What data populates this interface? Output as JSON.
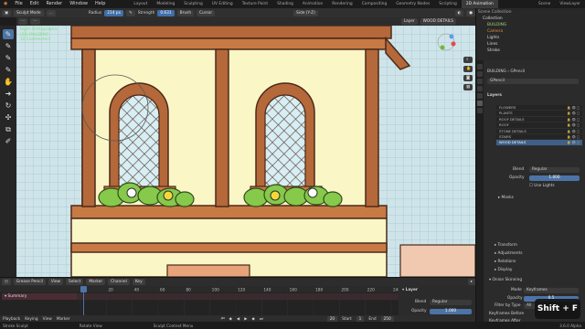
{
  "menubar": {
    "items": [
      "File",
      "Edit",
      "Render",
      "Window",
      "Help"
    ],
    "workspaces": [
      "Layout",
      "Modeling",
      "Sculpting",
      "UV Editing",
      "Texture Paint",
      "Shading",
      "Animation",
      "Rendering",
      "Compositing",
      "Geometry Nodes",
      "Scripting",
      "2D Animation"
    ],
    "active_workspace": "2D Animation",
    "scene_label": "Scene",
    "view_layer_label": "ViewLayer"
  },
  "header": {
    "mode": "Sculpt Mode",
    "radius_label": "Radius",
    "radius_value": "214 px",
    "strength_label": "Strength",
    "strength_value": "0.631",
    "brush": "Brush",
    "cursor": "Cursor",
    "view": "Side (Y-Z)"
  },
  "viewport_overlay": {
    "line1": "Right Orthographic",
    "line2": "(20) BUILDING",
    "line3": "10 Centimeters",
    "layer_name": "WOOD DETAILS"
  },
  "outliner": {
    "items": [
      "Scene Collection",
      "Collection",
      "BUILDING",
      "Camera",
      "Lights",
      "Lines",
      "Stroke"
    ]
  },
  "properties": {
    "breadcrumb_object": "BUILDING",
    "breadcrumb_data": "GPencil",
    "data_name": "GPencil",
    "layers_panel": "Layers",
    "layers": [
      "FLOWERS",
      "PLANTS",
      "ROOF DETAILS",
      "ROOF",
      "STONE DETAILS",
      "STAIRS",
      "WOOD DETAILS"
    ],
    "blend_label": "Blend",
    "blend_value": "Regular",
    "opacity_label": "Opacity",
    "opacity_value": "1.000",
    "use_lights": "Use Lights",
    "masks": "Masks",
    "sections": [
      "Transform",
      "Adjustments",
      "Relations",
      "Display"
    ],
    "onion": "Onion Skinning",
    "mode_label": "Mode",
    "mode_value": "Keyframes",
    "onion_opacity_label": "Opacity",
    "onion_opacity_value": "0.5",
    "filter_label": "Filter by Type",
    "filter_value": "All",
    "keyframes_before": "Keyframes Before",
    "keyframes_after": "Keyframes After"
  },
  "timeline": {
    "editor": "Grease Pencil",
    "menus": [
      "View",
      "Select",
      "Marker",
      "Channel",
      "Key"
    ],
    "mode": "Only Show Selected",
    "summary": "Summary",
    "ticks": [
      "0",
      "20",
      "40",
      "60",
      "80",
      "100",
      "120",
      "140",
      "160",
      "180",
      "200",
      "220",
      "240"
    ],
    "current_frame": "20",
    "layer_panel": "Layer",
    "blend_label": "Blend",
    "blend_value": "Regular",
    "opacity_label": "Opacity",
    "opacity_value": "1.000",
    "playback": "Playback",
    "keying": "Keying",
    "view": "View",
    "marker": "Marker",
    "frame": "20",
    "start_label": "Start",
    "start": "1",
    "end_label": "End",
    "end": "250"
  },
  "status": {
    "left": "Stroke Sculpt",
    "middle": "Rotate View",
    "right": "Sculpt Context Menu",
    "version": "3.6.0 Alpha"
  },
  "shortcut_overlay": "Shift + F",
  "colors": {
    "accent": "#4d74a6",
    "wood": "#b5683a",
    "wall": "#fbf6c6",
    "glass": "#d6eef4",
    "leaf": "#86c94b"
  }
}
